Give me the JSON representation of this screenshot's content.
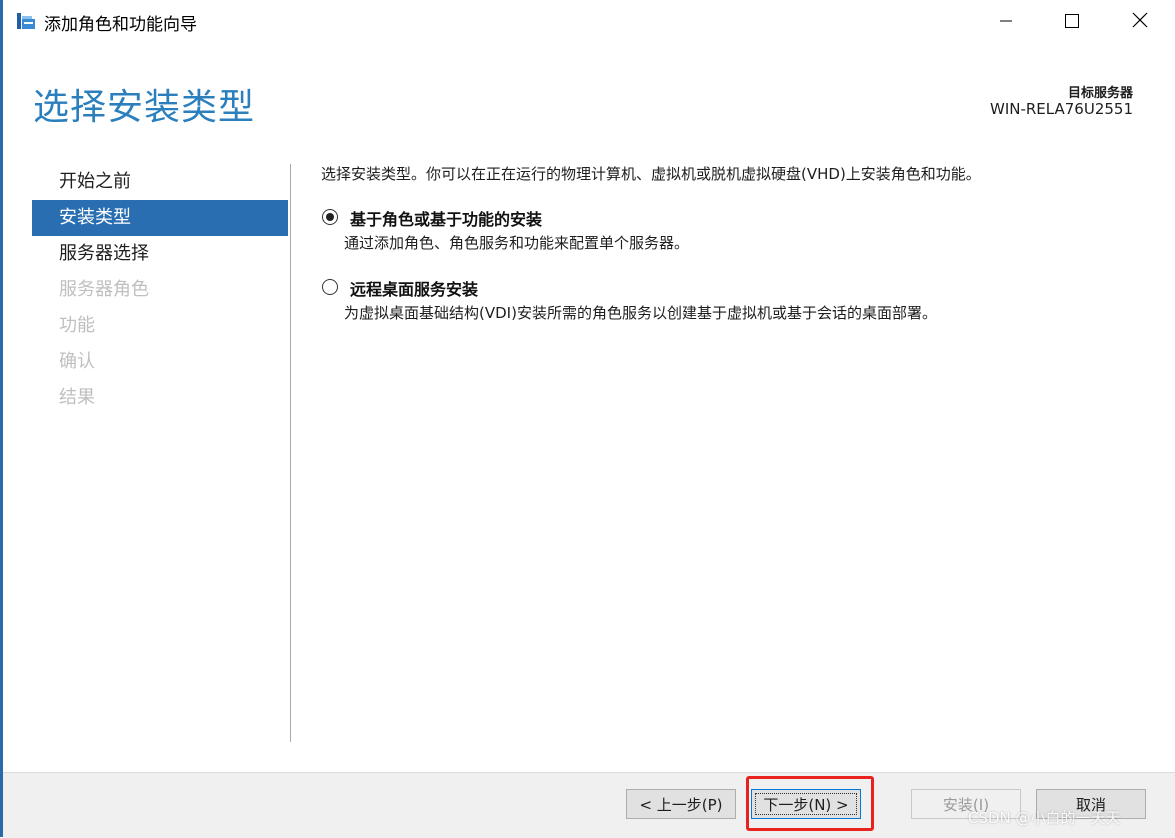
{
  "window": {
    "title": "添加角色和功能向导",
    "app_icon": "server-manager-icon",
    "controls": {
      "minimize": "minimize-icon",
      "maximize": "maximize-icon",
      "close": "close-icon"
    }
  },
  "header": {
    "title": "选择安装类型",
    "target_label": "目标服务器",
    "target_name": "WIN-RELA76U2551"
  },
  "nav": {
    "items": [
      {
        "label": "开始之前",
        "state": "normal"
      },
      {
        "label": "安装类型",
        "state": "active"
      },
      {
        "label": "服务器选择",
        "state": "normal"
      },
      {
        "label": "服务器角色",
        "state": "disabled"
      },
      {
        "label": "功能",
        "state": "disabled"
      },
      {
        "label": "确认",
        "state": "disabled"
      },
      {
        "label": "结果",
        "state": "disabled"
      }
    ]
  },
  "main": {
    "intro": "选择安装类型。你可以在正在运行的物理计算机、虚拟机或脱机虚拟硬盘(VHD)上安装角色和功能。",
    "options": [
      {
        "title": "基于角色或基于功能的安装",
        "description": "通过添加角色、角色服务和功能来配置单个服务器。",
        "selected": true
      },
      {
        "title": "远程桌面服务安装",
        "description": "为虚拟桌面基础结构(VDI)安装所需的角色服务以创建基于虚拟机或基于会话的桌面部署。",
        "selected": false
      }
    ]
  },
  "footer": {
    "prev": "< 上一步(P)",
    "next": "下一步(N) >",
    "install": "安装(I)",
    "cancel": "取消"
  },
  "annotation": {
    "highlight_color": "#e8221e"
  },
  "watermark": "CSDN @小白的一天天",
  "colors": {
    "accent": "#2a6eb2",
    "title": "#2b7fbd",
    "disabled": "#bfbfbf"
  }
}
